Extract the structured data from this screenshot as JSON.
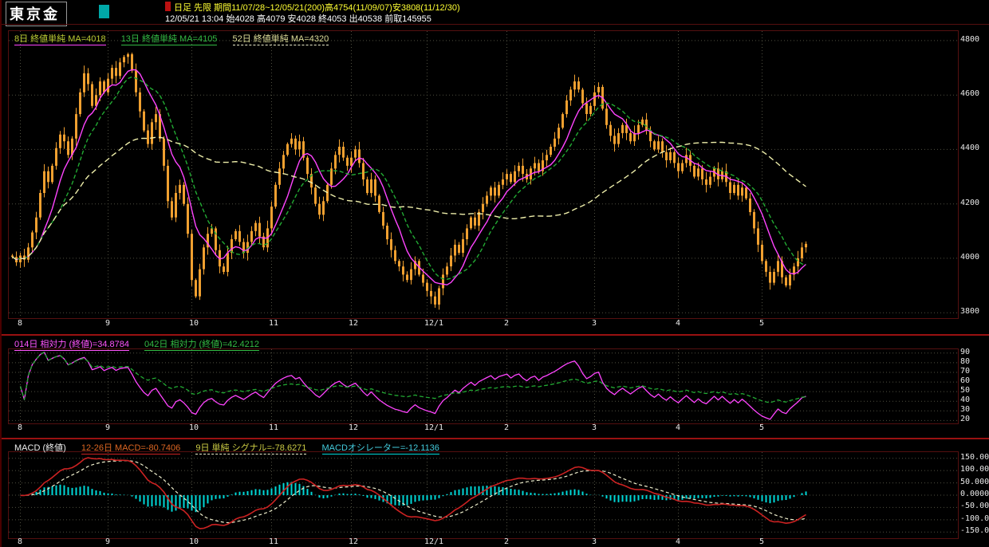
{
  "header": {
    "title": "東京金",
    "info1": "日足 先限 期間11/07/28~12/05/21(200)高4754(11/09/07)安3808(11/12/30)",
    "info2": "12/05/21 13:04 始4028 高4079 安4028 終4053 出40538 前取145955"
  },
  "main_legend": {
    "ma8": "8日 終値単純 MA=4018",
    "ma13": "13日 終値単純 MA=4105",
    "ma52": "52日 終値単純 MA=4320"
  },
  "rsi_legend": {
    "rsi14": "014日 相対力 (終値)=34.8784",
    "rsi42": "042日 相対力 (終値)=42.4212"
  },
  "macd_legend": {
    "title": "MACD (終値)",
    "macd": "12-26日 MACD=-80.7406",
    "signal": "9日 単純 シグナル=-78.6271",
    "osc": "MACDオシレーター=-12.1136"
  },
  "colors": {
    "candle": "#f0a030",
    "ma8": "#ff44ff",
    "ma13": "#22aa33",
    "ma52": "#eeeeaa",
    "rsi14": "#ff44ff",
    "rsi42": "#22aa33",
    "macd_line": "#cc2222",
    "signal_line": "#eeeecc",
    "histogram": "#00d8d8",
    "grid": "#4f4f40",
    "axis_text": "#e8e8e8",
    "divider": "#991111"
  },
  "x_axis": {
    "labels": [
      "8",
      "9",
      "10",
      "11",
      "12",
      "12/1",
      "2",
      "3",
      "4",
      "5"
    ],
    "tick_indices": [
      2,
      24,
      45,
      65,
      85,
      104,
      124,
      146,
      167,
      188
    ]
  },
  "chart_data": [
    {
      "type": "candlestick",
      "title": "東京金 日足 先限 2011/07/28-2012/05/21 (200本)",
      "ylim": [
        3780,
        4835
      ],
      "y_ticks": [
        3800,
        4000,
        4200,
        4400,
        4600,
        4800
      ],
      "open_first": 4010,
      "closes": [
        4005,
        3985,
        4010,
        3995,
        4040,
        4095,
        4150,
        4240,
        4320,
        4280,
        4340,
        4405,
        4455,
        4430,
        4380,
        4440,
        4530,
        4610,
        4680,
        4640,
        4560,
        4600,
        4650,
        4610,
        4660,
        4700,
        4670,
        4720,
        4740,
        4750,
        4690,
        4610,
        4540,
        4470,
        4420,
        4500,
        4530,
        4440,
        4340,
        4210,
        4150,
        4240,
        4270,
        4200,
        4090,
        3920,
        3860,
        3960,
        4040,
        4090,
        4110,
        4030,
        3970,
        3950,
        4020,
        4070,
        4100,
        4060,
        4020,
        4060,
        4100,
        4130,
        4080,
        4040,
        4110,
        4190,
        4270,
        4330,
        4380,
        4420,
        4440,
        4400,
        4430,
        4370,
        4310,
        4260,
        4200,
        4160,
        4210,
        4270,
        4330,
        4380,
        4410,
        4370,
        4340,
        4370,
        4400,
        4350,
        4290,
        4240,
        4290,
        4230,
        4170,
        4120,
        4070,
        4030,
        3990,
        3970,
        3940,
        3920,
        3960,
        3990,
        3940,
        3910,
        3880,
        3860,
        3830,
        3890,
        3940,
        3970,
        4010,
        4050,
        4020,
        4070,
        4110,
        4150,
        4120,
        4170,
        4200,
        4230,
        4260,
        4230,
        4270,
        4290,
        4310,
        4280,
        4320,
        4340,
        4310,
        4290,
        4330,
        4350,
        4320,
        4360,
        4380,
        4410,
        4440,
        4480,
        4530,
        4580,
        4620,
        4650,
        4620,
        4570,
        4530,
        4560,
        4610,
        4630,
        4550,
        4490,
        4450,
        4420,
        4460,
        4490,
        4460,
        4430,
        4460,
        4490,
        4510,
        4470,
        4430,
        4400,
        4430,
        4390,
        4360,
        4390,
        4350,
        4320,
        4350,
        4380,
        4340,
        4300,
        4330,
        4290,
        4270,
        4300,
        4330,
        4290,
        4320,
        4280,
        4240,
        4270,
        4230,
        4260,
        4220,
        4170,
        4110,
        4050,
        3990,
        3950,
        3910,
        3950,
        3990,
        3930,
        3900,
        3940,
        3970,
        4000,
        4040,
        4053
      ],
      "overlays": [
        {
          "name": "8日 終値単純移動平均",
          "period": 8,
          "last": 4018,
          "color": "#ff44ff",
          "dash": ""
        },
        {
          "name": "13日 終値単純移動平均",
          "period": 13,
          "last": 4105,
          "color": "#22aa33",
          "dash": "5,3"
        },
        {
          "name": "52日 終値単純移動平均",
          "period": 52,
          "last": 4320,
          "color": "#eeeeaa",
          "dash": "7,4"
        }
      ],
      "stats": {
        "period_high": 4754,
        "period_high_date": "11/09/07",
        "period_low": 3808,
        "period_low_date": "11/12/30",
        "open": 4028,
        "day_high": 4079,
        "day_low": 4028,
        "close": 4053,
        "volume": 40538,
        "prev": 145955
      }
    },
    {
      "type": "line",
      "title": "相対力指数 (RSI)",
      "ylim": [
        17,
        94
      ],
      "y_ticks": [
        20,
        30,
        40,
        50,
        60,
        70,
        80,
        90
      ],
      "series": [
        {
          "name": "014日 相対力(終値)",
          "period": 14,
          "last": 34.8784,
          "color": "#ff44ff",
          "dash": ""
        },
        {
          "name": "042日 相対力(終値)",
          "period": 42,
          "last": 42.4212,
          "color": "#22aa33",
          "dash": "5,3"
        }
      ],
      "derived_from": "candlestick closes"
    },
    {
      "type": "macd",
      "title": "MACD (12-26-9)",
      "ylim": [
        -175,
        175
      ],
      "y_ticks": [
        150,
        100,
        50,
        0,
        -50,
        -100,
        -150
      ],
      "tick_decimals": 4,
      "params": {
        "fast": 12,
        "slow": 26,
        "signal": 9
      },
      "last": {
        "macd": -80.7406,
        "signal": -78.6271,
        "oscillator": -12.1136
      },
      "derived_from": "candlestick closes"
    }
  ]
}
